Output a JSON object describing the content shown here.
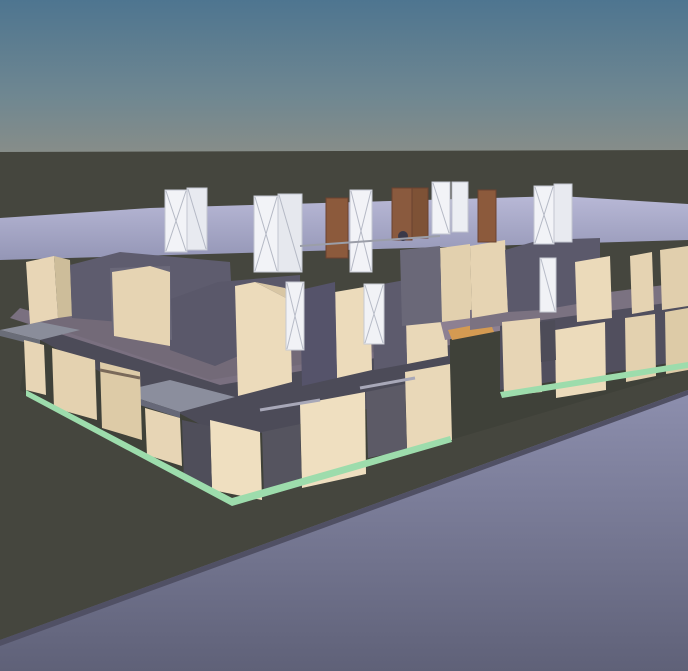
{
  "scene": {
    "kind": "3d-architectural-model-viewport",
    "colors": {
      "sky_top": "#4f7690",
      "sky_bottom": "#7e8b8a",
      "ground": "#47483f",
      "road": "#7c7f9a",
      "lot_slab": "#a6a7c8",
      "wall_beige": "#e7d5b5",
      "wall_beige_shadow": "#c9b893",
      "wall_slate": "#5e5c6e",
      "floor_slab": "#786f7a",
      "glass_panel": "#eef0f4",
      "wood_door": "#8c5a3c",
      "green_trim": "#9ddcac",
      "orange_floor": "#d49a52"
    }
  }
}
